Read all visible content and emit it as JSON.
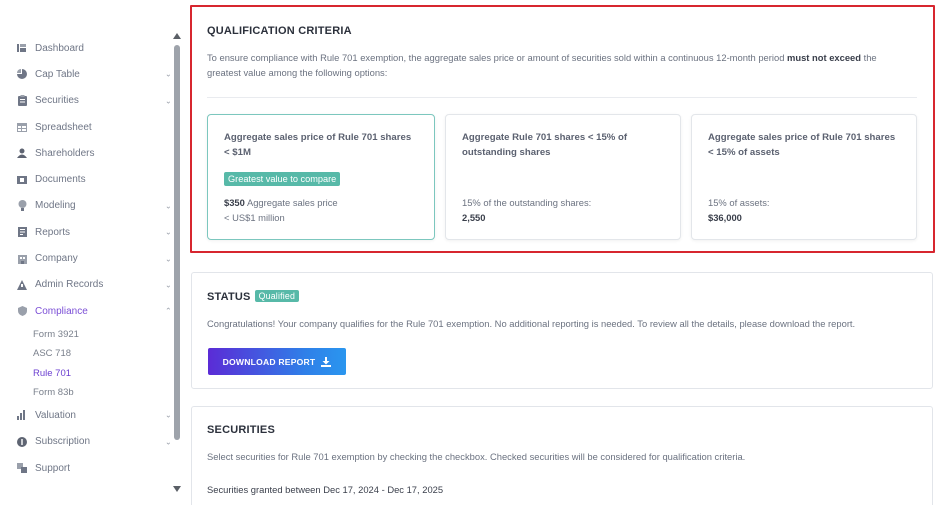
{
  "sidebar": {
    "items": [
      {
        "label": "Dashboard",
        "icon": "dashboard-icon",
        "chevron": false
      },
      {
        "label": "Cap Table",
        "icon": "pie-chart-icon",
        "chevron": true
      },
      {
        "label": "Securities",
        "icon": "clipboard-icon",
        "chevron": true
      },
      {
        "label": "Spreadsheet",
        "icon": "table-icon",
        "chevron": false
      },
      {
        "label": "Shareholders",
        "icon": "user-icon",
        "chevron": false
      },
      {
        "label": "Documents",
        "icon": "folder-icon",
        "chevron": false
      },
      {
        "label": "Modeling",
        "icon": "bulb-icon",
        "chevron": true
      },
      {
        "label": "Reports",
        "icon": "report-icon",
        "chevron": true
      },
      {
        "label": "Company",
        "icon": "building-icon",
        "chevron": true
      },
      {
        "label": "Admin Records",
        "icon": "records-icon",
        "chevron": true
      },
      {
        "label": "Compliance",
        "icon": "shield-icon",
        "chevron": true,
        "expanded": true
      }
    ],
    "compliance_sub": [
      {
        "label": "Form 3921"
      },
      {
        "label": "ASC 718"
      },
      {
        "label": "Rule 701",
        "active": true
      },
      {
        "label": "Form 83b"
      }
    ],
    "items_after": [
      {
        "label": "Valuation",
        "icon": "valuation-icon",
        "chevron": true
      },
      {
        "label": "Subscription",
        "icon": "dollar-icon",
        "chevron": true
      },
      {
        "label": "Support",
        "icon": "support-icon",
        "chevron": false
      }
    ]
  },
  "qualification": {
    "title": "QUALIFICATION CRITERIA",
    "desc_pre": "To ensure compliance with Rule 701 exemption, the aggregate sales price or amount of securities sold within a continuous 12-month period ",
    "desc_bold": "must not exceed",
    "desc_post": " the greatest value among the following options:",
    "options": [
      {
        "title": "Aggregate sales price of Rule 701 shares < $1M",
        "badge": "Greatest value to compare",
        "value_bold": "$350",
        "value_text": " Aggregate sales price",
        "value_line2": "< US$1 million"
      },
      {
        "title": "Aggregate Rule 701 shares < 15% of outstanding shares",
        "value_label": "15% of the outstanding shares:",
        "value": "2,550"
      },
      {
        "title": "Aggregate sales price of Rule 701 shares < 15% of assets",
        "value_label": "15% of assets:",
        "value": "$36,000"
      }
    ]
  },
  "status": {
    "title": "STATUS",
    "badge": "Qualified",
    "message": "Congratulations! Your company qualifies for the Rule 701 exemption. No additional reporting is needed. To review all the details, please download the report.",
    "download_label": "DOWNLOAD REPORT"
  },
  "securities": {
    "title": "SECURITIES",
    "desc": "Select securities for Rule 701 exemption by checking the checkbox. Checked securities will be considered for qualification criteria.",
    "range_text": "Securities granted between Dec 17, 2024 - Dec 17, 2025"
  },
  "colors": {
    "accent": "#7b4fd6",
    "badge": "#57b9a8",
    "highlight_border": "#d7262f"
  }
}
